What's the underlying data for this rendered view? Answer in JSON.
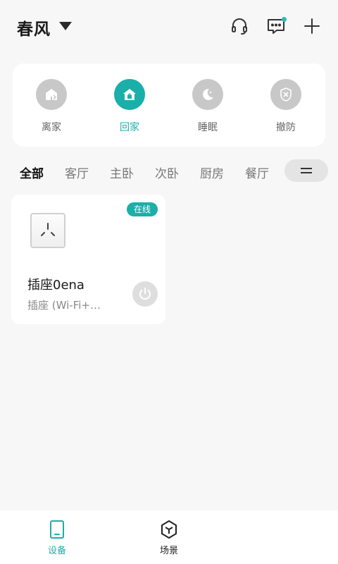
{
  "header": {
    "home_name": "春风",
    "icons": [
      "headset-icon",
      "message-icon",
      "plus-icon"
    ],
    "message_has_unread": true
  },
  "scenes": [
    {
      "label": "离家",
      "icon": "leave-home-icon",
      "active": false
    },
    {
      "label": "回家",
      "icon": "back-home-icon",
      "active": true
    },
    {
      "label": "睡眠",
      "icon": "moon-icon",
      "active": false
    },
    {
      "label": "撤防",
      "icon": "shield-x-icon",
      "active": false
    }
  ],
  "rooms": {
    "tabs": [
      "全部",
      "客厅",
      "主卧",
      "次卧",
      "厨房",
      "餐厅"
    ],
    "active_index": 0,
    "menu_icon": "menu-icon"
  },
  "devices": [
    {
      "name": "插座0ena",
      "type": "插座 (Wi-Fi+…",
      "status": "在线",
      "icon": "socket-icon",
      "power_icon": "power-icon"
    }
  ],
  "bottom_nav": [
    {
      "label": "设备",
      "icon": "tablet-icon",
      "active": true
    },
    {
      "label": "场景",
      "icon": "cube-icon",
      "active": false
    }
  ],
  "colors": {
    "accent": "#1aafa9",
    "background": "#f7f7f7",
    "inactive_circle": "#c8c8c8"
  }
}
